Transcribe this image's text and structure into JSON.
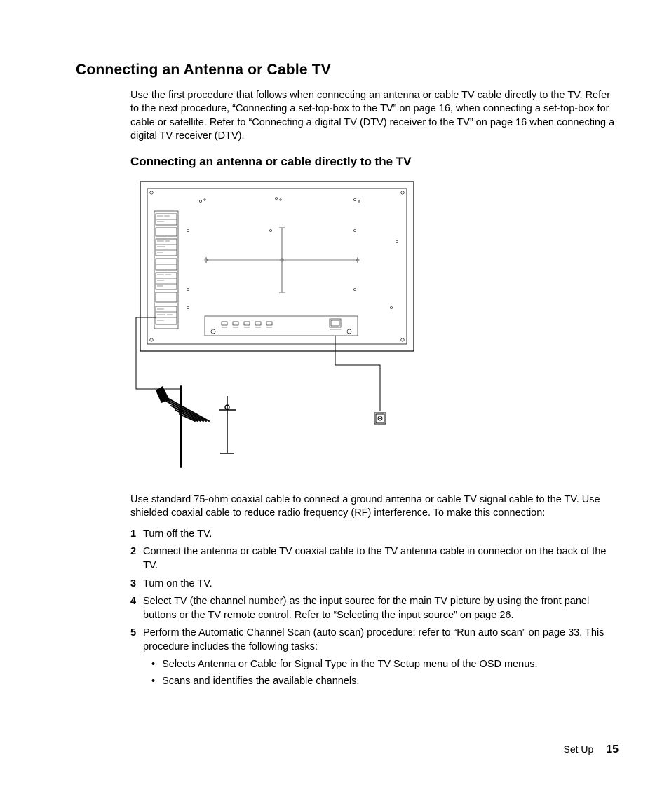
{
  "title": "Connecting an Antenna or Cable TV",
  "intro": "Use the first procedure that follows when connecting an antenna or cable TV cable directly to the TV. Refer to the next procedure, “Connecting a set-top-box to the TV” on page 16, when connecting a set-top-box for cable or satellite. Refer to “Connecting a digital TV (DTV) receiver to the TV” on page 16 when connecting a digital TV receiver (DTV).",
  "subhead": "Connecting an antenna or cable directly to the TV",
  "body": "Use standard 75-ohm coaxial cable to connect a ground antenna or cable TV signal cable to the TV. Use shielded coaxial cable to reduce radio frequency (RF) interference. To make this connection:",
  "steps": [
    {
      "n": "1",
      "text": "Turn off the TV."
    },
    {
      "n": "2",
      "text": "Connect the antenna or cable TV coaxial cable to the TV antenna cable in connector on the back of the TV."
    },
    {
      "n": "3",
      "text": "Turn on the TV."
    },
    {
      "n": "4",
      "text": "Select TV (the channel number) as the input source for the main TV picture by using the front panel buttons or the TV remote control. Refer to “Selecting the input source” on page 26."
    },
    {
      "n": "5",
      "text": "Perform the Automatic Channel Scan (auto scan) procedure; refer to “Run auto scan” on page 33. This procedure includes the following tasks:"
    }
  ],
  "bullets": [
    "Selects Antenna or Cable for Signal Type in the TV Setup menu of the OSD menus.",
    "Scans and identifies the available channels."
  ],
  "footer_label": "Set Up",
  "page_num": "15"
}
